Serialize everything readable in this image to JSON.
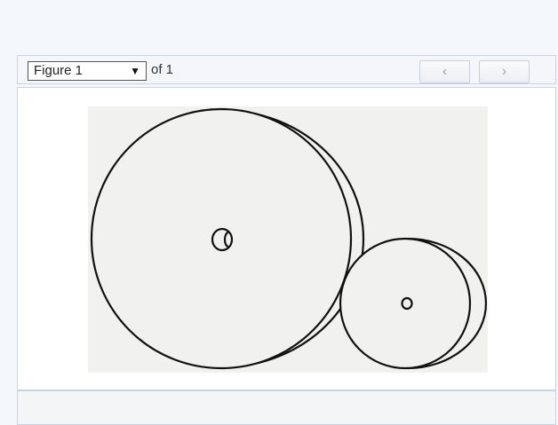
{
  "toolbar": {
    "figure_select": {
      "selected": "Figure 1"
    },
    "of_label": "of 1",
    "prev_icon": "chevron-left-icon",
    "next_icon": "chevron-right-icon",
    "prev_glyph": "‹",
    "next_glyph": "›"
  },
  "colors": {
    "page_background": "#f4f7fc",
    "panel_border": "#c9d3e3",
    "image_background": "#f1f1ef",
    "line": "#111111"
  }
}
